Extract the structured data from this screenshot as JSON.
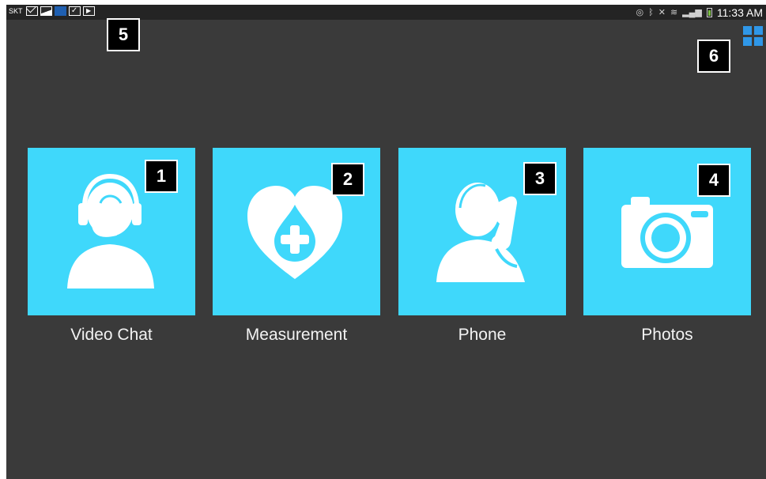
{
  "status_bar": {
    "carrier": "SKT",
    "notification_icons": [
      "mail-icon",
      "gallery-icon",
      "app-notification-icon",
      "clipboard-check-icon",
      "play-store-icon"
    ],
    "system_icons": [
      "eye-icon",
      "bluetooth-icon",
      "mute-icon",
      "wifi-icon",
      "signal-icon",
      "battery-charging-icon"
    ],
    "time": "11:33 AM"
  },
  "apps_grid_icon": "grid-view-icon",
  "tiles": [
    {
      "label": "Video Chat",
      "icon": "headset-agent-icon",
      "badge": "1"
    },
    {
      "label": "Measurement",
      "icon": "heart-drop-plus-icon",
      "badge": "2"
    },
    {
      "label": "Phone",
      "icon": "person-phone-icon",
      "badge": "3"
    },
    {
      "label": "Photos",
      "icon": "camera-icon",
      "badge": "4"
    }
  ],
  "badges": {
    "status_area": "5",
    "grid_icon": "6"
  },
  "colors": {
    "background": "#3a3a3a",
    "status_bar": "#242424",
    "tile": "#3fd8fb",
    "grid_icon": "#2f97e8",
    "badge_bg": "#000000"
  }
}
